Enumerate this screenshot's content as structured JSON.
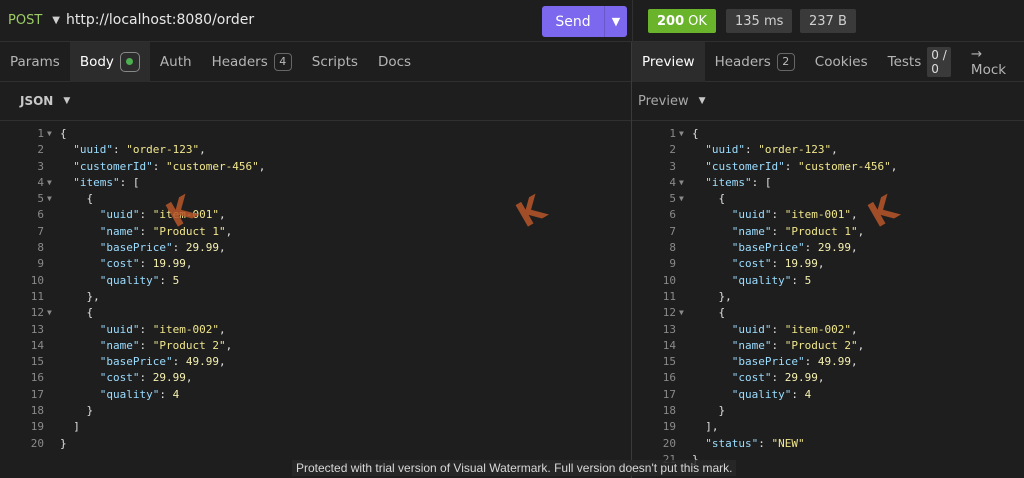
{
  "request": {
    "method": "POST",
    "url": "http://localhost:8080/order",
    "send_label": "Send"
  },
  "response": {
    "status_code": "200",
    "status_text": "OK",
    "time": "135 ms",
    "size": "237 B"
  },
  "request_tabs": {
    "params": "Params",
    "body": "Body",
    "auth": "Auth",
    "headers": "Headers",
    "headers_count": "4",
    "scripts": "Scripts",
    "docs": "Docs"
  },
  "response_tabs": {
    "preview": "Preview",
    "headers": "Headers",
    "headers_count": "2",
    "cookies": "Cookies",
    "tests": "Tests",
    "tests_count": "0 / 0",
    "mock": "→ Mock"
  },
  "body_format": "JSON",
  "preview_mode": "Preview",
  "request_body_lines": [
    "{",
    "  \"uuid\": \"order-123\",",
    "  \"customerId\": \"customer-456\",",
    "  \"items\": [",
    "    {",
    "      \"uuid\": \"item-001\",",
    "      \"name\": \"Product 1\",",
    "      \"basePrice\": 29.99,",
    "      \"cost\": 19.99,",
    "      \"quality\": 5",
    "    },",
    "    {",
    "      \"uuid\": \"item-002\",",
    "      \"name\": \"Product 2\",",
    "      \"basePrice\": 49.99,",
    "      \"cost\": 29.99,",
    "      \"quality\": 4",
    "    }",
    "  ]",
    "}"
  ],
  "response_body_lines": [
    "{",
    "  \"uuid\": \"order-123\",",
    "  \"customerId\": \"customer-456\",",
    "  \"items\": [",
    "    {",
    "      \"uuid\": \"item-001\",",
    "      \"name\": \"Product 1\",",
    "      \"basePrice\": 29.99,",
    "      \"cost\": 19.99,",
    "      \"quality\": 5",
    "    },",
    "    {",
    "      \"uuid\": \"item-002\",",
    "      \"name\": \"Product 2\",",
    "      \"basePrice\": 49.99,",
    "      \"cost\": 29.99,",
    "      \"quality\": 4",
    "    }",
    "  ],",
    "  \"status\": \"NEW\"",
    "}"
  ],
  "request_fold_lines": [
    1,
    4,
    5,
    12
  ],
  "response_fold_lines": [
    1,
    4,
    5,
    12
  ],
  "watermark_text": "Protected with trial version of Visual Watermark. Full version doesn't put this mark.",
  "watermark_glyph": "K",
  "colors": {
    "accent": "#7b68ee",
    "status_ok": "#6ab42c",
    "method": "#9ccc65",
    "json_key": "#9cdcfe",
    "json_string": "#f0e68c"
  }
}
